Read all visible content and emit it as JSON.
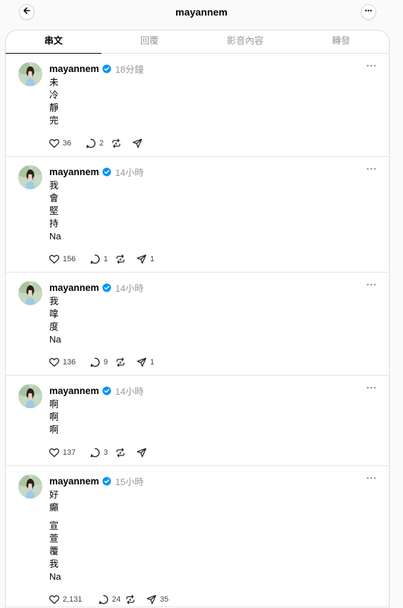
{
  "header": {
    "title": "mayannem"
  },
  "tabs": [
    {
      "label": "串文",
      "active": true
    },
    {
      "label": "回覆",
      "active": false
    },
    {
      "label": "影音內容",
      "active": false
    },
    {
      "label": "轉發",
      "active": false
    }
  ],
  "colors": {
    "verified_badge": "#0095f6",
    "muted_text": "#999999"
  },
  "posts": [
    {
      "username": "mayannem",
      "time": "18分鐘",
      "lines": [
        "未",
        "冷",
        "靜",
        "完"
      ],
      "likes": "36",
      "replies": "2",
      "reposts": "",
      "shares": ""
    },
    {
      "username": "mayannem",
      "time": "14小時",
      "lines": [
        "我",
        "會",
        "堅",
        "持",
        "Na"
      ],
      "likes": "156",
      "replies": "1",
      "reposts": "",
      "shares": "1"
    },
    {
      "username": "mayannem",
      "time": "14小時",
      "lines": [
        "我",
        "嗱",
        "度",
        "Na"
      ],
      "likes": "136",
      "replies": "9",
      "reposts": "",
      "shares": "1"
    },
    {
      "username": "mayannem",
      "time": "14小時",
      "lines": [
        "啊",
        "啊",
        "啊"
      ],
      "likes": "137",
      "replies": "3",
      "reposts": "",
      "shares": ""
    },
    {
      "username": "mayannem",
      "time": "15小時",
      "lines": [
        "好",
        "癲",
        "",
        "宣",
        "萱",
        "覆",
        "我",
        "Na"
      ],
      "likes": "2,131",
      "replies": "24",
      "reposts": "",
      "shares": "35"
    }
  ]
}
